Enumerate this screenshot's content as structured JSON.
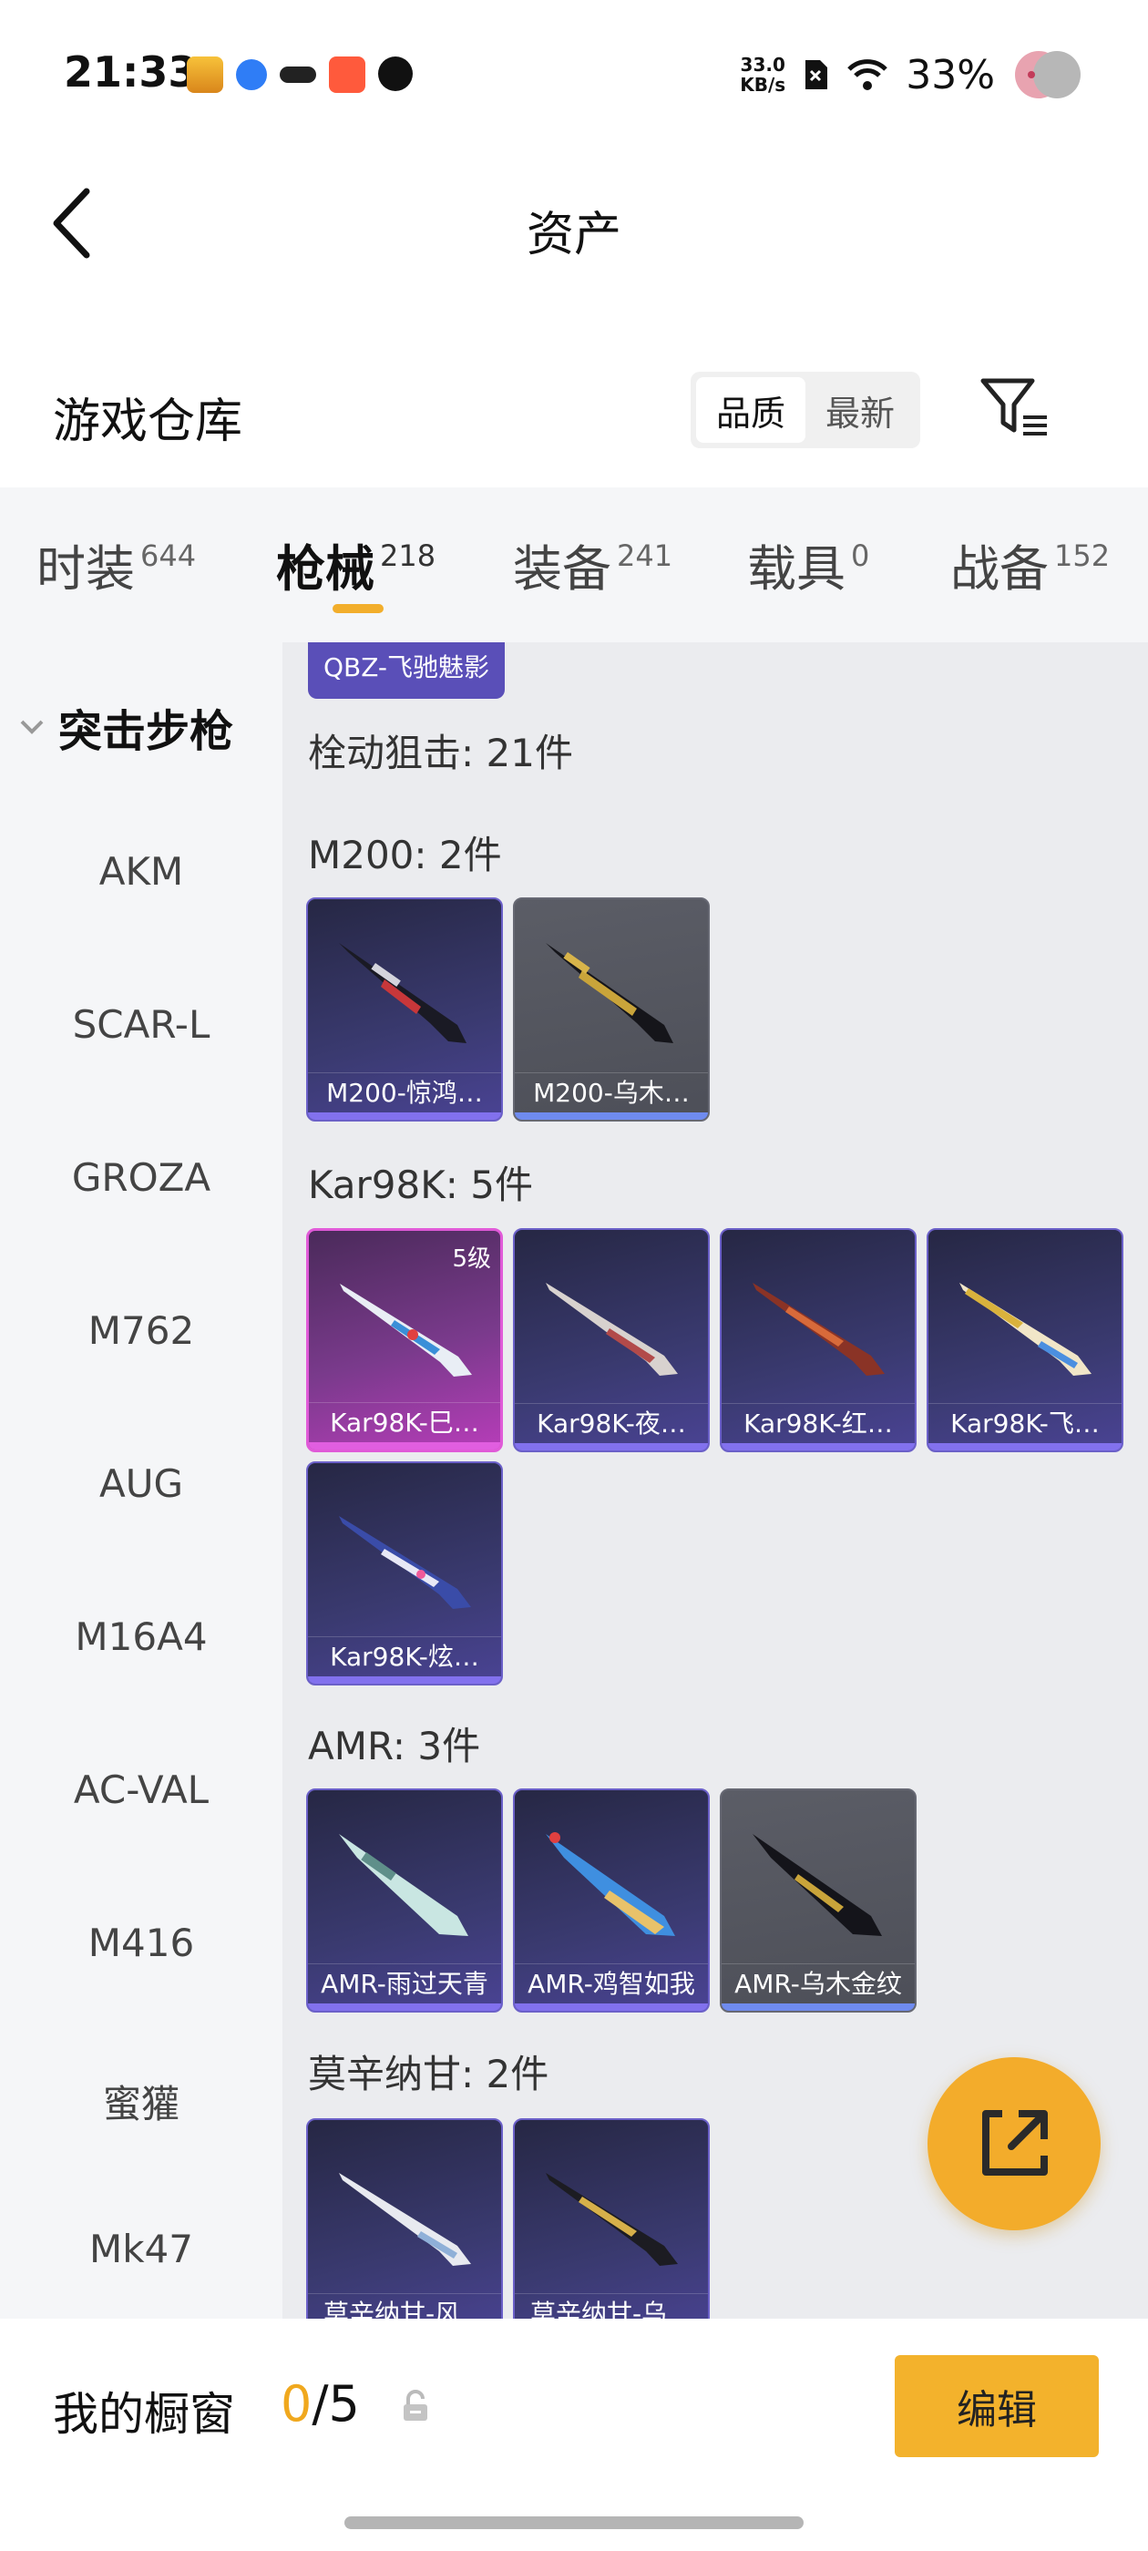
{
  "status_bar": {
    "time": "21:33",
    "net_speed_value": "33.0",
    "net_speed_unit": "KB/s",
    "battery": "33%"
  },
  "header": {
    "title": "资产"
  },
  "warehouse": {
    "title": "游戏仓库",
    "sort_options": [
      "品质",
      "最新"
    ],
    "active_sort": "品质"
  },
  "tabs": [
    {
      "label": "时装",
      "count": "644"
    },
    {
      "label": "枪械",
      "count": "218"
    },
    {
      "label": "装备",
      "count": "241"
    },
    {
      "label": "载具",
      "count": "0"
    },
    {
      "label": "战备",
      "count": "152"
    }
  ],
  "sidebar": {
    "category": "突击步枪",
    "items": [
      "AKM",
      "SCAR-L",
      "GROZA",
      "M762",
      "AUG",
      "M16A4",
      "AC-VAL",
      "M416",
      "蜜獾",
      "Mk47"
    ]
  },
  "content": {
    "partial_card_label": "QBZ-飞驰魅影",
    "section_title": "栓动狙击: 21件",
    "groups": [
      {
        "title": "M200: 2件",
        "items": [
          {
            "label": "M200-惊鸿…",
            "rarity": "epic"
          },
          {
            "label": "M200-乌木…",
            "rarity": "rare"
          }
        ]
      },
      {
        "title": "Kar98K: 5件",
        "items": [
          {
            "label": "Kar98K-巳…",
            "rarity": "legendary",
            "level": "5级"
          },
          {
            "label": "Kar98K-夜…",
            "rarity": "epic"
          },
          {
            "label": "Kar98K-红…",
            "rarity": "epic"
          },
          {
            "label": "Kar98K-飞…",
            "rarity": "epic"
          },
          {
            "label": "Kar98K-炫…",
            "rarity": "epic"
          }
        ]
      },
      {
        "title": "AMR: 3件",
        "items": [
          {
            "label": "AMR-雨过天青",
            "rarity": "epic"
          },
          {
            "label": "AMR-鸡智如我",
            "rarity": "epic"
          },
          {
            "label": "AMR-乌木金纹",
            "rarity": "rare"
          }
        ]
      },
      {
        "title": "莫辛纳甘: 2件",
        "items": [
          {
            "label": "莫辛纳甘-风…",
            "rarity": "epic"
          },
          {
            "label": "莫辛纳甘-乌…",
            "rarity": "epic"
          }
        ]
      }
    ]
  },
  "bottom": {
    "showcase_label": "我的橱窗",
    "showcase_current": "0",
    "showcase_total": "/5",
    "edit_label": "编辑"
  },
  "colors": {
    "accent": "#f3b22c",
    "epic_border": "#6b60c8",
    "legendary_border": "#e05ad8"
  }
}
